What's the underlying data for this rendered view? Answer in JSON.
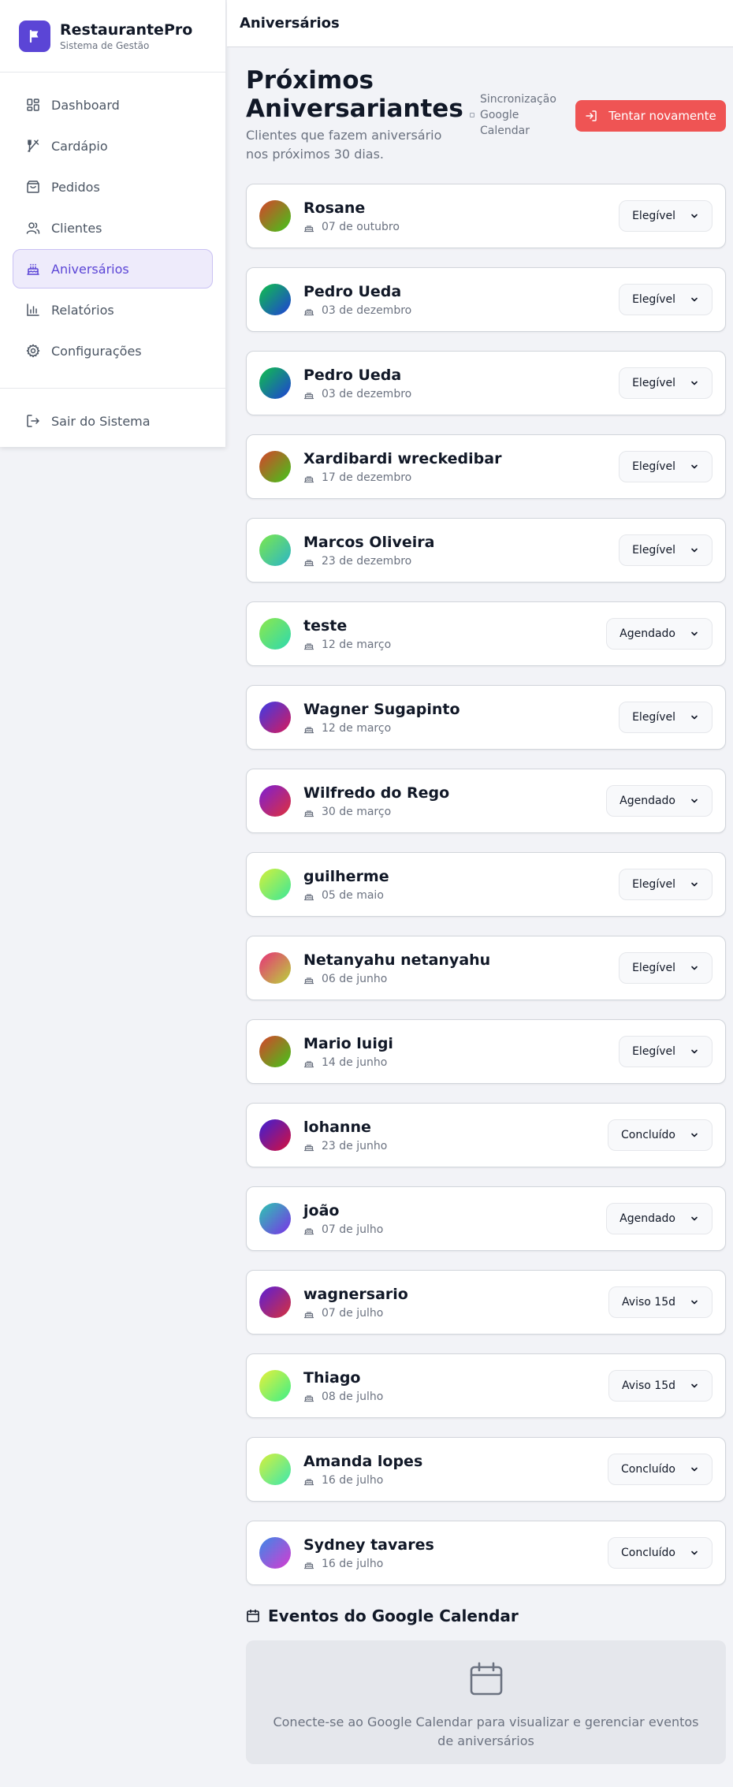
{
  "app": {
    "name": "RestaurantePro",
    "subtitle": "Sistema de Gestão"
  },
  "sidebar": {
    "items": [
      {
        "label": "Dashboard",
        "icon": "dashboard-icon"
      },
      {
        "label": "Cardápio",
        "icon": "utensils-icon"
      },
      {
        "label": "Pedidos",
        "icon": "shopping-bag-icon"
      },
      {
        "label": "Clientes",
        "icon": "users-icon"
      },
      {
        "label": "Aniversários",
        "icon": "cake-icon",
        "active": true
      },
      {
        "label": "Relatórios",
        "icon": "bar-chart-icon"
      },
      {
        "label": "Configurações",
        "icon": "gear-icon"
      }
    ],
    "logout_label": "Sair do Sistema"
  },
  "topbar": {
    "title": "Aniversários"
  },
  "header": {
    "title": "Próximos Aniversariantes",
    "subtitle": "Clientes que fazem aniversário nos próximos 30 dias.",
    "sync_label": "Sincronização Google Calendar",
    "retry_label": "Tentar novamente"
  },
  "birthdays": [
    {
      "name": "Rosane",
      "date": "07 de outubro",
      "status": "Elegível",
      "gradient": [
        "#d9412b",
        "#3fc81a"
      ]
    },
    {
      "name": "Pedro Ueda",
      "date": "03 de dezembro",
      "status": "Elegível",
      "gradient": [
        "#10c14a",
        "#1f3fd8"
      ]
    },
    {
      "name": "Pedro Ueda",
      "date": "03 de dezembro",
      "status": "Elegível",
      "gradient": [
        "#10c14a",
        "#1f3fd8"
      ]
    },
    {
      "name": "Xardibardi wreckedibar",
      "date": "17 de dezembro",
      "status": "Elegível",
      "gradient": [
        "#d9412b",
        "#3fc81a"
      ]
    },
    {
      "name": "Marcos Oliveira",
      "date": "23 de dezembro",
      "status": "Elegível",
      "gradient": [
        "#7ce84a",
        "#2bb5c9"
      ]
    },
    {
      "name": "teste",
      "date": "12 de março",
      "status": "Agendado",
      "gradient": [
        "#8ee84a",
        "#2cd9b0"
      ]
    },
    {
      "name": "Wagner Sugapinto",
      "date": "12 de março",
      "status": "Elegível",
      "gradient": [
        "#3b3be8",
        "#d81a5a"
      ]
    },
    {
      "name": "Wilfredo do Rego",
      "date": "30 de março",
      "status": "Agendado",
      "gradient": [
        "#7b1fd6",
        "#e0303a"
      ]
    },
    {
      "name": "guilherme",
      "date": "05 de maio",
      "status": "Elegível",
      "gradient": [
        "#d4f03a",
        "#3ae89a"
      ]
    },
    {
      "name": "Netanyahu netanyahu",
      "date": "06 de junho",
      "status": "Elegível",
      "gradient": [
        "#e8307a",
        "#b8d43a"
      ]
    },
    {
      "name": "Mario luigi",
      "date": "14 de junho",
      "status": "Elegível",
      "gradient": [
        "#d9412b",
        "#3fc81a"
      ]
    },
    {
      "name": "lohanne",
      "date": "23 de junho",
      "status": "Concluído",
      "gradient": [
        "#3a1fd8",
        "#d8103a"
      ]
    },
    {
      "name": "joão",
      "date": "07 de julho",
      "status": "Agendado",
      "gradient": [
        "#2bc9b0",
        "#7b2fe8"
      ]
    },
    {
      "name": "wagnersario",
      "date": "07 de julho",
      "status": "Aviso 15d",
      "gradient": [
        "#5a1fd8",
        "#d8303a"
      ]
    },
    {
      "name": "Thiago",
      "date": "08 de julho",
      "status": "Aviso 15d",
      "gradient": [
        "#e8f03a",
        "#3af08a"
      ]
    },
    {
      "name": "Amanda lopes",
      "date": "16 de julho",
      "status": "Concluído",
      "gradient": [
        "#d8f03a",
        "#3ae8b0"
      ]
    },
    {
      "name": "Sydney tavares",
      "date": "16 de julho",
      "status": "Concluído",
      "gradient": [
        "#3a8ae8",
        "#d83ad0"
      ]
    }
  ],
  "events": {
    "title": "Eventos do Google Calendar",
    "empty_text": "Conecte-se ao Google Calendar para visualizar e gerenciar eventos de aniversários"
  },
  "colors": {
    "brand": "#5b45d6",
    "danger": "#ef5454",
    "active_bg": "#eeebfb"
  }
}
